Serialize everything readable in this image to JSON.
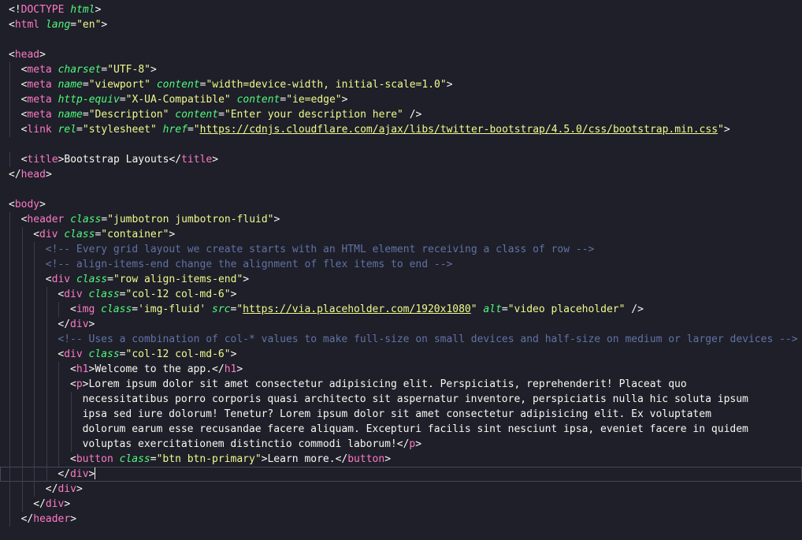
{
  "editor": {
    "lines": [
      {
        "indent": 0,
        "tokens": [
          [
            "p",
            "<!"
          ],
          [
            "tag",
            "DOCTYPE"
          ],
          [
            "p",
            " "
          ],
          [
            "attr",
            "html"
          ],
          [
            "p",
            ">"
          ]
        ]
      },
      {
        "indent": 0,
        "tokens": [
          [
            "p",
            "<"
          ],
          [
            "tag",
            "html"
          ],
          [
            "p",
            " "
          ],
          [
            "attr",
            "lang"
          ],
          [
            "p",
            "="
          ],
          [
            "str",
            "\"en\""
          ],
          [
            "p",
            ">"
          ]
        ]
      },
      {
        "indent": 0,
        "tokens": []
      },
      {
        "indent": 0,
        "tokens": [
          [
            "p",
            "<"
          ],
          [
            "tag",
            "head"
          ],
          [
            "p",
            ">"
          ]
        ]
      },
      {
        "indent": 1,
        "tokens": [
          [
            "p",
            "<"
          ],
          [
            "tag",
            "meta"
          ],
          [
            "p",
            " "
          ],
          [
            "attr",
            "charset"
          ],
          [
            "p",
            "="
          ],
          [
            "str",
            "\"UTF-8\""
          ],
          [
            "p",
            ">"
          ]
        ]
      },
      {
        "indent": 1,
        "tokens": [
          [
            "p",
            "<"
          ],
          [
            "tag",
            "meta"
          ],
          [
            "p",
            " "
          ],
          [
            "attr",
            "name"
          ],
          [
            "p",
            "="
          ],
          [
            "str",
            "\"viewport\""
          ],
          [
            "p",
            " "
          ],
          [
            "attr",
            "content"
          ],
          [
            "p",
            "="
          ],
          [
            "str",
            "\"width=device-width, initial-scale=1.0\""
          ],
          [
            "p",
            ">"
          ]
        ]
      },
      {
        "indent": 1,
        "tokens": [
          [
            "p",
            "<"
          ],
          [
            "tag",
            "meta"
          ],
          [
            "p",
            " "
          ],
          [
            "attr",
            "http-equiv"
          ],
          [
            "p",
            "="
          ],
          [
            "str",
            "\"X-UA-Compatible\""
          ],
          [
            "p",
            " "
          ],
          [
            "attr",
            "content"
          ],
          [
            "p",
            "="
          ],
          [
            "str",
            "\"ie=edge\""
          ],
          [
            "p",
            ">"
          ]
        ]
      },
      {
        "indent": 1,
        "tokens": [
          [
            "p",
            "<"
          ],
          [
            "tag",
            "meta"
          ],
          [
            "p",
            " "
          ],
          [
            "attr",
            "name"
          ],
          [
            "p",
            "="
          ],
          [
            "str",
            "\"Description\""
          ],
          [
            "p",
            " "
          ],
          [
            "attr",
            "content"
          ],
          [
            "p",
            "="
          ],
          [
            "str",
            "\"Enter your description here\""
          ],
          [
            "p",
            " />"
          ]
        ]
      },
      {
        "indent": 1,
        "tokens": [
          [
            "p",
            "<"
          ],
          [
            "tag",
            "link"
          ],
          [
            "p",
            " "
          ],
          [
            "attr",
            "rel"
          ],
          [
            "p",
            "="
          ],
          [
            "str",
            "\"stylesheet\""
          ],
          [
            "p",
            " "
          ],
          [
            "attr",
            "href"
          ],
          [
            "p",
            "="
          ],
          [
            "str",
            "\""
          ],
          [
            "link",
            "https://cdnjs.cloudflare.com/ajax/libs/twitter-bootstrap/4.5.0/css/bootstrap.min.css"
          ],
          [
            "str",
            "\""
          ],
          [
            "p",
            ">"
          ]
        ]
      },
      {
        "indent": 0,
        "tokens": []
      },
      {
        "indent": 1,
        "tokens": [
          [
            "p",
            "<"
          ],
          [
            "tag",
            "title"
          ],
          [
            "p",
            ">"
          ],
          [
            "text",
            "Bootstrap Layouts"
          ],
          [
            "p",
            "</"
          ],
          [
            "tag",
            "title"
          ],
          [
            "p",
            ">"
          ]
        ]
      },
      {
        "indent": 0,
        "tokens": [
          [
            "p",
            "</"
          ],
          [
            "tag",
            "head"
          ],
          [
            "p",
            ">"
          ]
        ]
      },
      {
        "indent": 0,
        "tokens": []
      },
      {
        "indent": 0,
        "tokens": [
          [
            "p",
            "<"
          ],
          [
            "tag",
            "body"
          ],
          [
            "p",
            ">"
          ]
        ]
      },
      {
        "indent": 1,
        "tokens": [
          [
            "p",
            "<"
          ],
          [
            "tag",
            "header"
          ],
          [
            "p",
            " "
          ],
          [
            "attr",
            "class"
          ],
          [
            "p",
            "="
          ],
          [
            "str",
            "\"jumbotron jumbotron-fluid\""
          ],
          [
            "p",
            ">"
          ]
        ]
      },
      {
        "indent": 2,
        "tokens": [
          [
            "p",
            "<"
          ],
          [
            "tag",
            "div"
          ],
          [
            "p",
            " "
          ],
          [
            "attr",
            "class"
          ],
          [
            "p",
            "="
          ],
          [
            "str",
            "\"container\""
          ],
          [
            "p",
            ">"
          ]
        ]
      },
      {
        "indent": 3,
        "tokens": [
          [
            "comment",
            "<!-- Every grid layout we create starts with an HTML element receiving a class of row -->"
          ]
        ]
      },
      {
        "indent": 3,
        "tokens": [
          [
            "comment",
            "<!-- align-items-end change the alignment of flex items to end -->"
          ]
        ]
      },
      {
        "indent": 3,
        "tokens": [
          [
            "p",
            "<"
          ],
          [
            "tag",
            "div"
          ],
          [
            "p",
            " "
          ],
          [
            "attr",
            "class"
          ],
          [
            "p",
            "="
          ],
          [
            "str",
            "\"row align-items-end\""
          ],
          [
            "p",
            ">"
          ]
        ]
      },
      {
        "indent": 4,
        "tokens": [
          [
            "p",
            "<"
          ],
          [
            "tag",
            "div"
          ],
          [
            "p",
            " "
          ],
          [
            "attr",
            "class"
          ],
          [
            "p",
            "="
          ],
          [
            "str",
            "\"col-12 col-md-6\""
          ],
          [
            "p",
            ">"
          ]
        ]
      },
      {
        "indent": 5,
        "tokens": [
          [
            "p",
            "<"
          ],
          [
            "tag",
            "img"
          ],
          [
            "p",
            " "
          ],
          [
            "attr",
            "class"
          ],
          [
            "p",
            "="
          ],
          [
            "str",
            "'img-fluid'"
          ],
          [
            "p",
            " "
          ],
          [
            "attr",
            "src"
          ],
          [
            "p",
            "="
          ],
          [
            "str",
            "\""
          ],
          [
            "link",
            "https://via.placeholder.com/1920x1080"
          ],
          [
            "str",
            "\""
          ],
          [
            "p",
            " "
          ],
          [
            "attr",
            "alt"
          ],
          [
            "p",
            "="
          ],
          [
            "str",
            "\"video placeholder\""
          ],
          [
            "p",
            " />"
          ]
        ]
      },
      {
        "indent": 4,
        "tokens": [
          [
            "p",
            "</"
          ],
          [
            "tag",
            "div"
          ],
          [
            "p",
            ">"
          ]
        ]
      },
      {
        "indent": 4,
        "tokens": [
          [
            "comment",
            "<!-- Uses a combination of col-* values to make full-size on small devices and half-size on medium or larger devices -->"
          ]
        ]
      },
      {
        "indent": 4,
        "tokens": [
          [
            "p",
            "<"
          ],
          [
            "tag",
            "div"
          ],
          [
            "p",
            " "
          ],
          [
            "attr",
            "class"
          ],
          [
            "p",
            "="
          ],
          [
            "str",
            "\"col-12 col-md-6\""
          ],
          [
            "p",
            ">"
          ]
        ]
      },
      {
        "indent": 5,
        "tokens": [
          [
            "p",
            "<"
          ],
          [
            "tag",
            "h1"
          ],
          [
            "p",
            ">"
          ],
          [
            "text",
            "Welcome to the app."
          ],
          [
            "p",
            "</"
          ],
          [
            "tag",
            "h1"
          ],
          [
            "p",
            ">"
          ]
        ]
      },
      {
        "indent": 5,
        "tokens": [
          [
            "p",
            "<"
          ],
          [
            "tag",
            "p"
          ],
          [
            "p",
            ">"
          ],
          [
            "text",
            "Lorem ipsum dolor sit amet consectetur adipisicing elit. Perspiciatis, reprehenderit! Placeat quo"
          ]
        ]
      },
      {
        "indent": 6,
        "tokens": [
          [
            "text",
            "necessitatibus porro corporis quasi architecto sit aspernatur inventore, perspiciatis nulla hic soluta ipsum"
          ]
        ]
      },
      {
        "indent": 6,
        "tokens": [
          [
            "text",
            "ipsa sed iure dolorum! Tenetur? Lorem ipsum dolor sit amet consectetur adipisicing elit. Ex voluptatem"
          ]
        ]
      },
      {
        "indent": 6,
        "tokens": [
          [
            "text",
            "dolorum earum esse recusandae facere aliquam. Excepturi facilis sint nesciunt ipsa, eveniet facere in quidem"
          ]
        ]
      },
      {
        "indent": 6,
        "tokens": [
          [
            "text",
            "voluptas exercitationem distinctio commodi laborum!"
          ],
          [
            "p",
            "</"
          ],
          [
            "tag",
            "p"
          ],
          [
            "p",
            ">"
          ]
        ]
      },
      {
        "indent": 5,
        "tokens": [
          [
            "p",
            "<"
          ],
          [
            "tag",
            "button"
          ],
          [
            "p",
            " "
          ],
          [
            "attr",
            "class"
          ],
          [
            "p",
            "="
          ],
          [
            "str",
            "\"btn btn-primary\""
          ],
          [
            "p",
            ">"
          ],
          [
            "text",
            "Learn more."
          ],
          [
            "p",
            "</"
          ],
          [
            "tag",
            "button"
          ],
          [
            "p",
            ">"
          ]
        ]
      },
      {
        "indent": 4,
        "tokens": [
          [
            "p",
            "</"
          ],
          [
            "tag",
            "div"
          ],
          [
            "p",
            ">"
          ]
        ],
        "current": true
      },
      {
        "indent": 3,
        "tokens": [
          [
            "p",
            "</"
          ],
          [
            "tag",
            "div"
          ],
          [
            "p",
            ">"
          ]
        ]
      },
      {
        "indent": 2,
        "tokens": [
          [
            "p",
            "</"
          ],
          [
            "tag",
            "div"
          ],
          [
            "p",
            ">"
          ]
        ]
      },
      {
        "indent": 1,
        "tokens": [
          [
            "p",
            "</"
          ],
          [
            "tag",
            "header"
          ],
          [
            "p",
            ">"
          ]
        ]
      },
      {
        "indent": 0,
        "tokens": []
      }
    ]
  }
}
